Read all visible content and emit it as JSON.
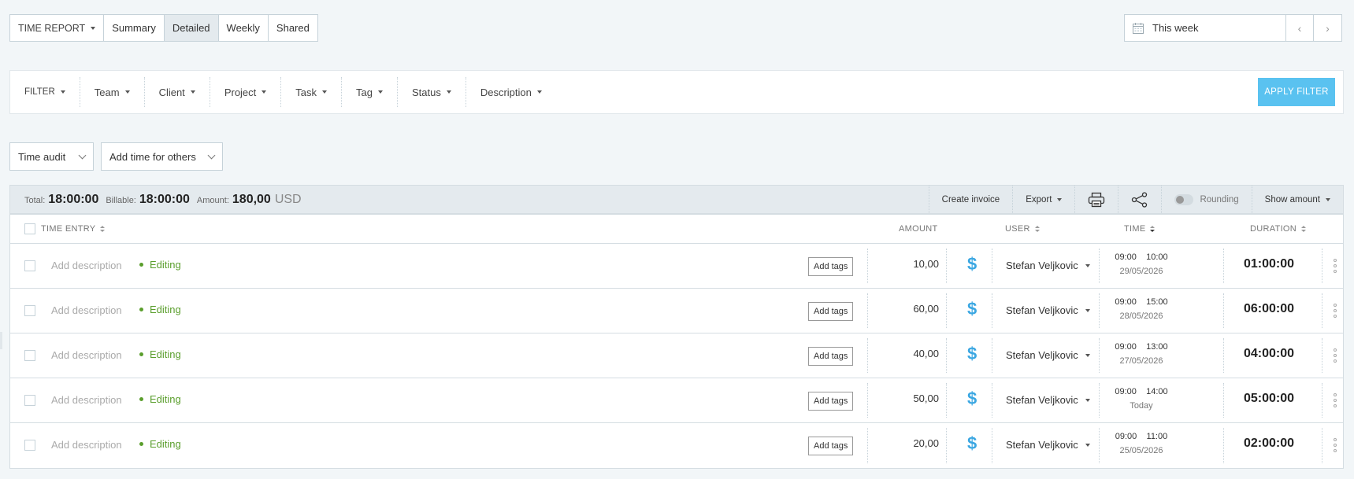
{
  "topbar": {
    "report_label": "TIME REPORT",
    "tabs": [
      {
        "label": "Summary"
      },
      {
        "label": "Detailed"
      },
      {
        "label": "Weekly"
      },
      {
        "label": "Shared"
      }
    ],
    "active_tab": "Detailed"
  },
  "daterange": {
    "value": "This week",
    "prev_label": "‹",
    "next_label": "›"
  },
  "filters": {
    "items": [
      {
        "label": "FILTER"
      },
      {
        "label": "Team"
      },
      {
        "label": "Client"
      },
      {
        "label": "Project"
      },
      {
        "label": "Task"
      },
      {
        "label": "Tag"
      },
      {
        "label": "Status"
      },
      {
        "label": "Description"
      }
    ],
    "apply_label": "APPLY FILTER"
  },
  "audit": {
    "time_audit_label": "Time audit",
    "add_time_label": "Add time for others"
  },
  "totals": {
    "total_label": "Total:",
    "total_value": "18:00:00",
    "billable_label": "Billable:",
    "billable_value": "18:00:00",
    "amount_label": "Amount:",
    "amount_value": "180,00",
    "currency": "USD",
    "actions": {
      "create_invoice": "Create invoice",
      "export": "Export",
      "rounding": "Rounding",
      "show_amount": "Show amount"
    }
  },
  "table": {
    "headers": {
      "time_entry": "TIME ENTRY",
      "amount": "AMOUNT",
      "user": "USER",
      "time": "TIME",
      "duration": "DURATION"
    },
    "rows": [
      {
        "description": "Add description",
        "project": "Editing",
        "tags": "Add tags",
        "amount": "10,00",
        "billable": "$",
        "user": "Stefan Veljkovic",
        "start": "09:00",
        "end": "10:00",
        "date": "29/05/2026",
        "duration": "01:00:00"
      },
      {
        "description": "Add description",
        "project": "Editing",
        "tags": "Add tags",
        "amount": "60,00",
        "billable": "$",
        "user": "Stefan Veljkovic",
        "start": "09:00",
        "end": "15:00",
        "date": "28/05/2026",
        "duration": "06:00:00"
      },
      {
        "description": "Add description",
        "project": "Editing",
        "tags": "Add tags",
        "amount": "40,00",
        "billable": "$",
        "user": "Stefan Veljkovic",
        "start": "09:00",
        "end": "13:00",
        "date": "27/05/2026",
        "duration": "04:00:00"
      },
      {
        "description": "Add description",
        "project": "Editing",
        "tags": "Add tags",
        "amount": "50,00",
        "billable": "$",
        "user": "Stefan Veljkovic",
        "start": "09:00",
        "end": "14:00",
        "date": "Today",
        "duration": "05:00:00"
      },
      {
        "description": "Add description",
        "project": "Editing",
        "tags": "Add tags",
        "amount": "20,00",
        "billable": "$",
        "user": "Stefan Veljkovic",
        "start": "09:00",
        "end": "11:00",
        "date": "25/05/2026",
        "duration": "02:00:00"
      }
    ]
  },
  "colors": {
    "accent": "#5ac2f0",
    "project": "#5a9e2c",
    "billable": "#3ba7e2"
  }
}
